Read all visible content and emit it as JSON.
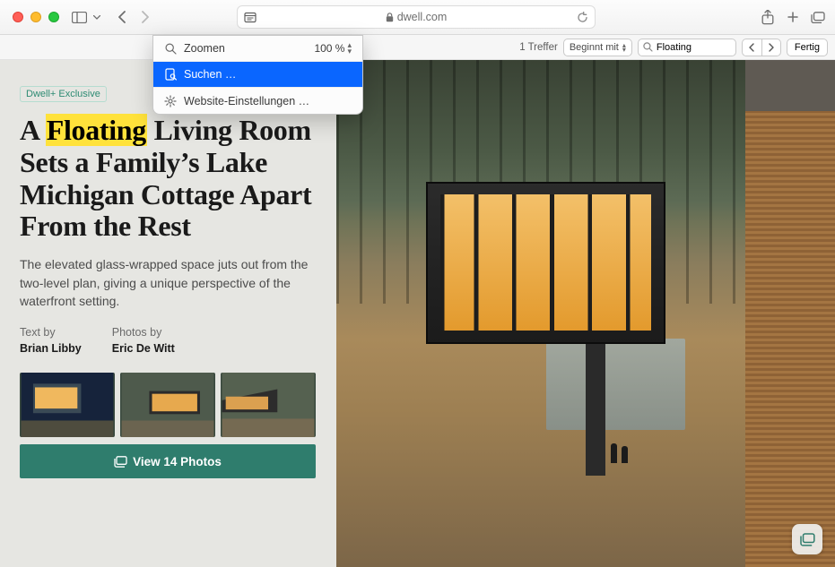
{
  "toolbar": {
    "url_host": "dwell.com"
  },
  "findbar": {
    "count_label": "1 Treffer",
    "mode_label": "Beginnt mit",
    "query": "Floating",
    "done_label": "Fertig"
  },
  "reader_menu": {
    "zoom_label": "Zoomen",
    "zoom_value": "100 %",
    "search_label": "Suchen …",
    "settings_label": "Website-Einstellungen …"
  },
  "article": {
    "kicker": "Dwell+ Exclusive",
    "headline_pre": "A ",
    "headline_hit": "Floating",
    "headline_post": " Living Room Sets a Family’s Lake Michigan Cottage Apart From the Rest",
    "dek": "The elevated glass-wrapped space juts out from the two-level plan, giving a unique perspective of the waterfront setting.",
    "byline": {
      "text_label": "Text by",
      "text_name": "Brian Libby",
      "photo_label": "Photos by",
      "photo_name": "Eric De Witt"
    },
    "view_all_label": "View 14 Photos"
  }
}
